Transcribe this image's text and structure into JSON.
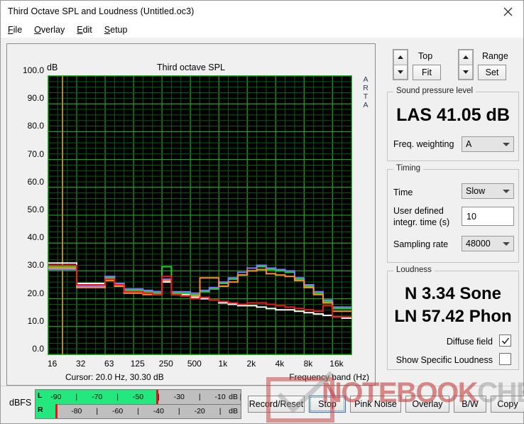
{
  "window": {
    "title": "Third Octave SPL and Loudness (Untitled.oc3)",
    "close_icon": "close-icon"
  },
  "menu": [
    {
      "label": "File",
      "accel": "F"
    },
    {
      "label": "Overlay",
      "accel": "O"
    },
    {
      "label": "Edit",
      "accel": "E"
    },
    {
      "label": "Setup",
      "accel": "S"
    }
  ],
  "graph": {
    "title": "Third octave SPL",
    "y_unit": "dB",
    "watermark_label": "ARTA",
    "cursor_text": "Cursor:   20.0 Hz, 30.30 dB",
    "x_axis_label": "Frequency band (Hz)"
  },
  "chart_data": {
    "type": "line",
    "title": "Third octave SPL",
    "xlabel": "Frequency band (Hz)",
    "ylabel": "dB",
    "ylim": [
      0.0,
      100.0
    ],
    "ytick_labels": [
      "100.0",
      "90.0",
      "80.0",
      "70.0",
      "60.0",
      "50.0",
      "40.0",
      "30.0",
      "20.0",
      "10.0",
      "0.0"
    ],
    "ytick_values": [
      100,
      90,
      80,
      70,
      60,
      50,
      40,
      30,
      20,
      10,
      0
    ],
    "xtick_labels": [
      "16",
      "32",
      "63",
      "125",
      "250",
      "500",
      "1k",
      "2k",
      "4k",
      "8k",
      "16k"
    ],
    "x_bands": [
      16,
      20,
      25,
      31.5,
      40,
      50,
      63,
      80,
      100,
      125,
      160,
      200,
      250,
      315,
      400,
      500,
      630,
      800,
      1000,
      1250,
      1600,
      2000,
      2500,
      3150,
      4000,
      5000,
      6300,
      8000,
      10000,
      12500,
      16000,
      20000
    ],
    "grid": true,
    "legend": "none",
    "cursor_marker": {
      "freq_hz": 20.0,
      "level_db": 30.3,
      "color": "#b08b10"
    },
    "series": [
      {
        "name": "trace-white",
        "color": "#ffffff",
        "values": [
          32.8,
          32.8,
          32.8,
          25.5,
          25.5,
          25.5,
          27.5,
          25.0,
          23.0,
          23.0,
          22.5,
          22.5,
          26.0,
          22.0,
          21.5,
          20.5,
          20.0,
          19.5,
          18.5,
          18.0,
          17.5,
          17.5,
          17.0,
          16.5,
          16.0,
          16.0,
          15.5,
          15.0,
          14.5,
          14.0,
          13.5,
          13.0
        ]
      },
      {
        "name": "trace-green",
        "color": "#1fd41f",
        "values": [
          31.5,
          31.5,
          31.5,
          25.0,
          25.0,
          25.0,
          27.5,
          25.5,
          23.0,
          23.0,
          22.5,
          22.0,
          31.5,
          22.0,
          22.0,
          21.5,
          22.5,
          23.5,
          25.5,
          27.0,
          28.5,
          30.0,
          31.5,
          30.5,
          30.0,
          29.5,
          27.0,
          24.5,
          22.0,
          19.0,
          16.5,
          16.5
        ]
      },
      {
        "name": "trace-violet",
        "color": "#7b7bff",
        "values": [
          30.5,
          30.5,
          30.5,
          24.5,
          24.5,
          24.5,
          28.0,
          25.5,
          23.5,
          23.5,
          23.0,
          22.5,
          27.0,
          22.5,
          22.5,
          22.0,
          23.0,
          24.0,
          26.0,
          27.5,
          29.5,
          31.0,
          32.0,
          31.0,
          30.5,
          30.0,
          27.5,
          25.0,
          22.5,
          19.5,
          17.0,
          17.0
        ]
      },
      {
        "name": "trace-orange",
        "color": "#ff8c36",
        "values": [
          31.0,
          31.0,
          31.0,
          24.0,
          24.0,
          24.0,
          26.5,
          24.5,
          22.0,
          22.0,
          21.5,
          21.5,
          26.5,
          21.5,
          21.0,
          21.0,
          27.5,
          27.5,
          24.5,
          26.0,
          28.5,
          30.0,
          30.5,
          29.0,
          28.5,
          28.0,
          26.5,
          24.0,
          21.5,
          18.5,
          15.5,
          15.5
        ]
      },
      {
        "name": "trace-red",
        "color": "#f21818",
        "values": [
          32.0,
          32.0,
          32.0,
          25.0,
          25.0,
          25.0,
          27.0,
          25.0,
          22.5,
          22.5,
          22.0,
          21.5,
          28.0,
          21.5,
          21.0,
          20.0,
          20.5,
          19.5,
          19.0,
          18.5,
          18.0,
          18.5,
          18.5,
          18.0,
          17.5,
          17.0,
          16.5,
          16.0,
          15.5,
          17.5,
          13.5,
          13.5
        ]
      }
    ]
  },
  "top_control": {
    "label": "Top",
    "button": "Fit",
    "spinner_up": "arrow-up-icon",
    "spinner_down": "arrow-down-icon"
  },
  "range_control": {
    "label": "Range",
    "button": "Set",
    "spinner_up": "arrow-up-icon",
    "spinner_down": "arrow-down-icon"
  },
  "spl": {
    "group_title": "Sound pressure level",
    "value": "LAS 41.05 dB",
    "weighting_label": "Freq. weighting",
    "weighting_value": "A"
  },
  "timing": {
    "group_title": "Timing",
    "time_label": "Time",
    "time_value": "Slow",
    "integr_label_line1": "User defined",
    "integr_label_line2": "integr. time (s)",
    "integr_value": "10",
    "sampling_label": "Sampling rate",
    "sampling_value": "48000"
  },
  "loudness": {
    "group_title": "Loudness",
    "value_line1": "N 3.34 Sone",
    "value_line2": "LN 57.42 Phon",
    "diffuse_label": "Diffuse field",
    "diffuse_checked": true,
    "specific_label": "Show Specific Loudness",
    "specific_checked": false
  },
  "meter": {
    "unit_label": "dBFS",
    "left_channel": "L",
    "right_channel": "R",
    "left_fill_percent": 59,
    "left_peak_percent": 59,
    "right_fill_percent": 10,
    "right_peak_percent": 10,
    "row_unit": "dB",
    "top_ticks": [
      "-90",
      "-70",
      "-50",
      "-30",
      "-10"
    ],
    "bottom_ticks": [
      "-80",
      "-60",
      "-40",
      "-20"
    ]
  },
  "buttons": [
    {
      "label": "Record/Reset",
      "focused": false
    },
    {
      "label": "Stop",
      "focused": true
    },
    {
      "label": "Pink Noise",
      "focused": false
    },
    {
      "label": "Overlay",
      "focused": false
    },
    {
      "label": "B/W",
      "focused": false
    },
    {
      "label": "Copy",
      "focused": false
    }
  ],
  "watermark": {
    "part1": "NOTEBOOK",
    "part2": "CHECK"
  }
}
